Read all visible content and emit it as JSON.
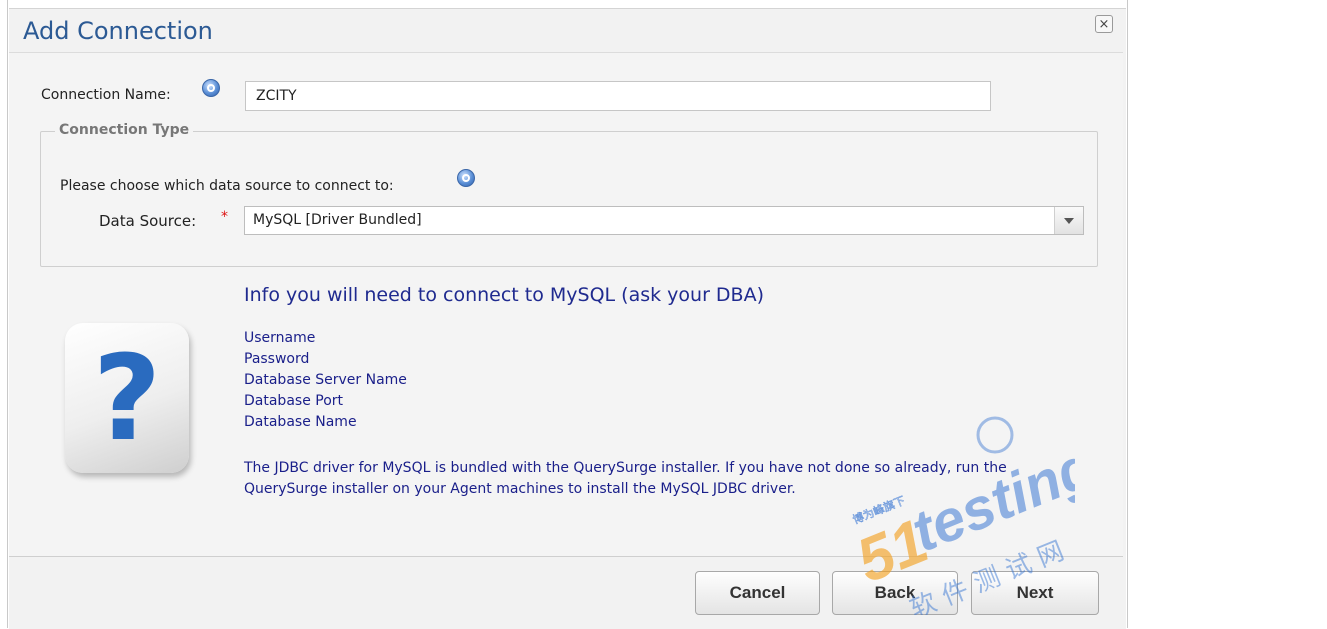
{
  "dialog": {
    "title": "Add Connection",
    "close_symbol": "×"
  },
  "connection_name": {
    "label": "Connection Name:",
    "value": "ZCITY"
  },
  "connection_type": {
    "legend": "Connection Type",
    "prompt": "Please choose which data source to connect to:",
    "data_source_label": "Data Source:",
    "required_marker": "*",
    "data_source_value": "MySQL [Driver Bundled]"
  },
  "info": {
    "icon_glyph": "?",
    "title": "Info you will need to connect to MySQL (ask your DBA)",
    "items": [
      "Username",
      "Password",
      "Database Server Name",
      "Database Port",
      "Database Name"
    ],
    "note": "The JDBC driver for MySQL is bundled with the QuerySurge installer. If you have not done so already, run the QuerySurge installer on your Agent machines to install the MySQL JDBC driver."
  },
  "buttons": {
    "cancel": "Cancel",
    "back": "Back",
    "next": "Next"
  },
  "watermark": {
    "brand_number": "51",
    "brand_text": "testing",
    "badge_text": "博为峰旗下",
    "cn_text": "软 件 测 试 网"
  },
  "colors": {
    "title": "#2c5a94",
    "info_text": "#1a1f8a",
    "required": "#dd1111",
    "watermark_blue": "#2f6fd0",
    "watermark_orange": "#f3a020"
  },
  "icons": [
    "help-icon",
    "question-mark-icon",
    "close-icon",
    "chevron-down-icon"
  ]
}
